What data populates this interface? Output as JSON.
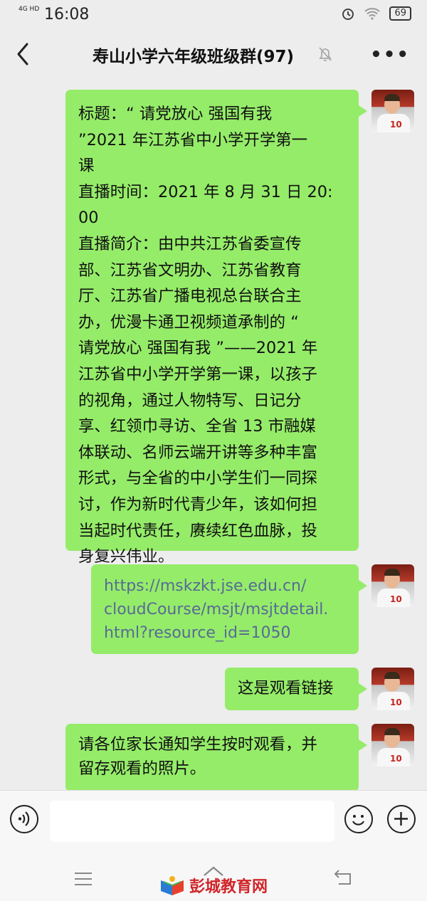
{
  "status_bar": {
    "network": "4G HD",
    "time": "16:08",
    "battery": "69"
  },
  "header": {
    "title": "寿山小学六年级班级群(97)"
  },
  "messages": [
    {
      "type": "text",
      "lines": [
        "标题：“ 请党放心 强国有我",
        "”2021 年江苏省中小学开学第一",
        "课",
        "直播时间：2021 年 8 月 31 日 20:",
        "00",
        "直播简介：由中共江苏省委宣传",
        "部、江苏省文明办、江苏省教育",
        "厅、江苏省广播电视总台联合主",
        "办，优漫卡通卫视频道承制的 “",
        "请党放心 强国有我 ”——2021 年",
        "江苏省中小学开学第一课，以孩子",
        "的视角，通过人物特写、日记分",
        "享、红领巾寻访、全省 13 市融媒",
        "体联动、名师云端开讲等多种丰富",
        "形式，与全省的中小学生们一同探",
        "讨，作为新时代青少年，该如何担",
        "当起时代责任，赓续红色血脉，投",
        "身复兴伟业。"
      ]
    },
    {
      "type": "link",
      "lines": [
        "https://mskzkt.jse.edu.cn/",
        "cloudCourse/msjt/msjtdetail.",
        "html?resource_id=1050"
      ]
    },
    {
      "type": "text",
      "lines": [
        "这是观看链接"
      ]
    },
    {
      "type": "text",
      "lines": [
        "请各位家长通知学生按时观看，并",
        "留存观看的照片。"
      ]
    }
  ],
  "avatar": {
    "jersey_number": "10"
  },
  "input": {
    "placeholder": ""
  },
  "watermark": {
    "text": "彭城教育网"
  },
  "colors": {
    "bubble": "#95ec69",
    "link": "#576b95",
    "background": "#ededed"
  }
}
